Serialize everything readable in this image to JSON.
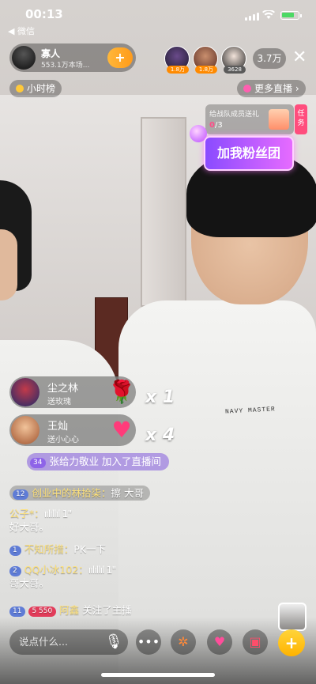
{
  "status": {
    "time": "00:13",
    "back_label": "◀ 微信"
  },
  "host": {
    "name": "寡人",
    "subtitle": "553.1万本场...",
    "follow_label": "+"
  },
  "viewers": [
    {
      "badge": "1.8万"
    },
    {
      "badge": "1.8万"
    },
    {
      "badge": "3628"
    }
  ],
  "viewer_count": "3.7万",
  "close_label": "✕",
  "hour_rank_label": "小时榜",
  "more_live_label": "更多直播",
  "task": {
    "text": "给战队成员送礼",
    "progress_done": "0",
    "progress_total": "/3",
    "tab_label": "任务"
  },
  "fan_button_label": "加我粉丝团",
  "gifts": [
    {
      "name": "尘之林",
      "desc": "送玫瑰",
      "icon": "rose-icon",
      "multiplier": "x 1"
    },
    {
      "name": "王灿",
      "desc": "送小心心",
      "icon": "heart-icon",
      "multiplier": "x 4"
    }
  ],
  "join": {
    "level": "34",
    "text": "张给力敬业 加入了直播间"
  },
  "chat": [
    {
      "level": "12",
      "user": "创业中的林拾柒：",
      "msg": "擦 大哥"
    },
    {
      "user": "公子*：",
      "msg": "ıılıllıl 1\"",
      "msg2": "好大哥。"
    },
    {
      "level": "1",
      "user": "不知所措：",
      "msg": "PK一下"
    },
    {
      "level": "2",
      "user": "QQ小冰102：",
      "msg": "ıılıllıl 1\"",
      "msg2": "哥大哥。"
    },
    {
      "level": "11",
      "badge": "5 550",
      "user": "阿鑫",
      "msg": "关注了主播"
    }
  ],
  "input_placeholder": "说点什么...",
  "shirt_text": "NAVY MASTER",
  "colors": {
    "accent": "#ff4d7d",
    "gold": "#ffb300",
    "purple": "#8a4bff"
  }
}
